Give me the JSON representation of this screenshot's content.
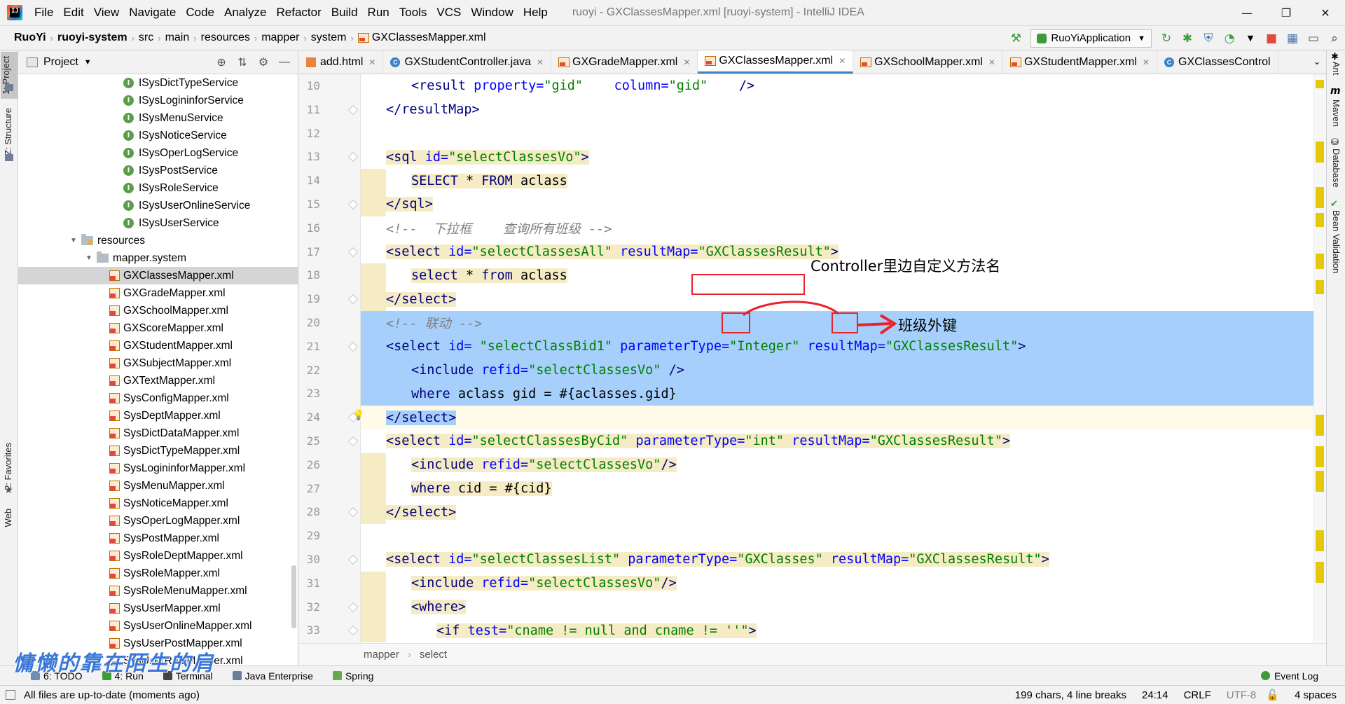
{
  "window": {
    "title": "ruoyi - GXClassesMapper.xml [ruoyi-system] - IntelliJ IDEA",
    "logo_text": "IJ",
    "menu": [
      "File",
      "Edit",
      "View",
      "Navigate",
      "Code",
      "Analyze",
      "Refactor",
      "Build",
      "Run",
      "Tools",
      "VCS",
      "Window",
      "Help"
    ],
    "minimize": "—",
    "maximize": "❐",
    "close": "✕"
  },
  "navbar": {
    "breadcrumb": [
      "RuoYi",
      "ruoyi-system",
      "src",
      "main",
      "resources",
      "mapper",
      "system",
      "GXClassesMapper.xml"
    ],
    "run_config": "RuoYiApplication"
  },
  "left_stripe": {
    "project": "1: Project",
    "structure": "Z: Structure",
    "favorites": "2: Favorites",
    "web": "Web"
  },
  "right_stripe": {
    "ant": "Ant",
    "maven": "Maven",
    "database": "Database",
    "bean": "Bean Validation"
  },
  "project_panel": {
    "title": "Project",
    "tree": [
      {
        "label": "ISysDictTypeService",
        "type": "interface",
        "indent": 150
      },
      {
        "label": "ISysLogininforService",
        "type": "interface",
        "indent": 150
      },
      {
        "label": "ISysMenuService",
        "type": "interface",
        "indent": 150
      },
      {
        "label": "ISysNoticeService",
        "type": "interface",
        "indent": 150
      },
      {
        "label": "ISysOperLogService",
        "type": "interface",
        "indent": 150
      },
      {
        "label": "ISysPostService",
        "type": "interface",
        "indent": 150
      },
      {
        "label": "ISysRoleService",
        "type": "interface",
        "indent": 150
      },
      {
        "label": "ISysUserOnlineService",
        "type": "interface",
        "indent": 150
      },
      {
        "label": "ISysUserService",
        "type": "interface",
        "indent": 150
      },
      {
        "label": "resources",
        "type": "res-folder",
        "indent": 72,
        "arrow": "▼"
      },
      {
        "label": "mapper.system",
        "type": "folder",
        "indent": 94,
        "arrow": "▼"
      },
      {
        "label": "GXClassesMapper.xml",
        "type": "xml",
        "indent": 130,
        "selected": true
      },
      {
        "label": "GXGradeMapper.xml",
        "type": "xml",
        "indent": 130
      },
      {
        "label": "GXSchoolMapper.xml",
        "type": "xml",
        "indent": 130
      },
      {
        "label": "GXScoreMapper.xml",
        "type": "xml",
        "indent": 130
      },
      {
        "label": "GXStudentMapper.xml",
        "type": "xml",
        "indent": 130
      },
      {
        "label": "GXSubjectMapper.xml",
        "type": "xml",
        "indent": 130
      },
      {
        "label": "GXTextMapper.xml",
        "type": "xml",
        "indent": 130
      },
      {
        "label": "SysConfigMapper.xml",
        "type": "xml",
        "indent": 130
      },
      {
        "label": "SysDeptMapper.xml",
        "type": "xml",
        "indent": 130
      },
      {
        "label": "SysDictDataMapper.xml",
        "type": "xml",
        "indent": 130
      },
      {
        "label": "SysDictTypeMapper.xml",
        "type": "xml",
        "indent": 130
      },
      {
        "label": "SysLogininforMapper.xml",
        "type": "xml",
        "indent": 130
      },
      {
        "label": "SysMenuMapper.xml",
        "type": "xml",
        "indent": 130
      },
      {
        "label": "SysNoticeMapper.xml",
        "type": "xml",
        "indent": 130
      },
      {
        "label": "SysOperLogMapper.xml",
        "type": "xml",
        "indent": 130
      },
      {
        "label": "SysPostMapper.xml",
        "type": "xml",
        "indent": 130
      },
      {
        "label": "SysRoleDeptMapper.xml",
        "type": "xml",
        "indent": 130
      },
      {
        "label": "SysRoleMapper.xml",
        "type": "xml",
        "indent": 130
      },
      {
        "label": "SysRoleMenuMapper.xml",
        "type": "xml",
        "indent": 130
      },
      {
        "label": "SysUserMapper.xml",
        "type": "xml",
        "indent": 130
      },
      {
        "label": "SysUserOnlineMapper.xml",
        "type": "xml",
        "indent": 130
      },
      {
        "label": "SysUserPostMapper.xml",
        "type": "xml",
        "indent": 130
      },
      {
        "label": "SysUserRoleMapper.xml",
        "type": "xml",
        "indent": 130
      }
    ]
  },
  "tabs": [
    {
      "label": "add.html",
      "icon": "html"
    },
    {
      "label": "GXStudentController.java",
      "icon": "class"
    },
    {
      "label": "GXGradeMapper.xml",
      "icon": "xml"
    },
    {
      "label": "GXClassesMapper.xml",
      "icon": "xml",
      "active": true
    },
    {
      "label": "GXSchoolMapper.xml",
      "icon": "xml"
    },
    {
      "label": "GXStudentMapper.xml",
      "icon": "xml"
    },
    {
      "label": "GXClassesControl",
      "icon": "class"
    }
  ],
  "tabs_overflow": "⌄",
  "editor": {
    "lines": [
      {
        "n": "10",
        "hl": "none",
        "indent": 2,
        "parts": [
          [
            "tag",
            "<result "
          ],
          [
            "attr",
            "property="
          ],
          [
            "val",
            "\"gid\""
          ],
          [
            "plain",
            "    "
          ],
          [
            "attr",
            "column="
          ],
          [
            "val",
            "\"gid\""
          ],
          [
            "plain",
            "    "
          ],
          [
            "tag",
            "/>"
          ]
        ]
      },
      {
        "n": "11",
        "hl": "none",
        "indent": 1,
        "parts": [
          [
            "tag",
            "</resultMap>"
          ]
        ]
      },
      {
        "n": "12",
        "hl": "none",
        "indent": 0,
        "parts": []
      },
      {
        "n": "13",
        "hl": "yellow",
        "indent": 1,
        "parts": [
          [
            "tag",
            "<sql "
          ],
          [
            "attr",
            "id="
          ],
          [
            "val",
            "\"selectClassesVo\""
          ],
          [
            "tag",
            ">"
          ]
        ]
      },
      {
        "n": "14",
        "hl": "yellow",
        "indent": 2,
        "parts": [
          [
            "sql",
            "SELECT"
          ],
          [
            "plain",
            " * "
          ],
          [
            "sql",
            "FROM"
          ],
          [
            "plain",
            " aclass"
          ]
        ]
      },
      {
        "n": "15",
        "hl": "yellow",
        "indent": 1,
        "parts": [
          [
            "tag",
            "</sql>"
          ]
        ]
      },
      {
        "n": "16",
        "hl": "none",
        "indent": 1,
        "parts": [
          [
            "cmt",
            "<!--  下拉框    查询所有班级 -->"
          ]
        ]
      },
      {
        "n": "17",
        "hl": "yellow",
        "indent": 1,
        "parts": [
          [
            "tag",
            "<select "
          ],
          [
            "attr",
            "id="
          ],
          [
            "val",
            "\"selectClassesAll\""
          ],
          [
            "plain",
            " "
          ],
          [
            "attr",
            "resultMap="
          ],
          [
            "val",
            "\"GXClassesResult\""
          ],
          [
            "tag",
            ">"
          ]
        ]
      },
      {
        "n": "18",
        "hl": "yellow",
        "indent": 2,
        "parts": [
          [
            "sql",
            "select"
          ],
          [
            "plain",
            " * "
          ],
          [
            "sql",
            "from"
          ],
          [
            "plain",
            " aclass"
          ]
        ]
      },
      {
        "n": "19",
        "hl": "yellow",
        "indent": 1,
        "parts": [
          [
            "tag",
            "</select>"
          ]
        ]
      },
      {
        "n": "20",
        "hl": "blue",
        "indent": 1,
        "parts": [
          [
            "cmt",
            "<!-- 联动 -->"
          ]
        ]
      },
      {
        "n": "21",
        "hl": "blue",
        "indent": 1,
        "parts": [
          [
            "tag",
            "<select "
          ],
          [
            "attr",
            "id= "
          ],
          [
            "val",
            "\"selectClassBid1\""
          ],
          [
            "plain",
            " "
          ],
          [
            "attr",
            "parameterType="
          ],
          [
            "val",
            "\"Integer\""
          ],
          [
            "plain",
            " "
          ],
          [
            "attr",
            "resultMap="
          ],
          [
            "val",
            "\"GXClassesResult\""
          ],
          [
            "tag",
            ">"
          ]
        ]
      },
      {
        "n": "22",
        "hl": "blue",
        "indent": 2,
        "parts": [
          [
            "tag",
            "<include "
          ],
          [
            "attr",
            "refid="
          ],
          [
            "val",
            "\"selectClassesVo\""
          ],
          [
            "plain",
            " "
          ],
          [
            "tag",
            "/>"
          ]
        ]
      },
      {
        "n": "23",
        "hl": "blue",
        "indent": 2,
        "parts": [
          [
            "sql",
            "where"
          ],
          [
            "plain",
            " aclass "
          ],
          [
            "plain",
            "gid"
          ],
          [
            "plain",
            " = #{aclasses.gid}"
          ]
        ]
      },
      {
        "n": "24",
        "hl": "caret",
        "indent": 1,
        "parts": [
          [
            "tag",
            "</select>"
          ]
        ]
      },
      {
        "n": "25",
        "hl": "yellow",
        "indent": 1,
        "parts": [
          [
            "tag",
            "<select "
          ],
          [
            "attr",
            "id="
          ],
          [
            "val",
            "\"selectClassesByCid\""
          ],
          [
            "plain",
            " "
          ],
          [
            "attr",
            "parameterType="
          ],
          [
            "val",
            "\"int\""
          ],
          [
            "plain",
            " "
          ],
          [
            "attr",
            "resultMap="
          ],
          [
            "val",
            "\"GXClassesResult\""
          ],
          [
            "tag",
            ">"
          ]
        ]
      },
      {
        "n": "26",
        "hl": "yellow",
        "indent": 2,
        "parts": [
          [
            "tag",
            "<include "
          ],
          [
            "attr",
            "refid="
          ],
          [
            "val",
            "\"selectClassesVo\""
          ],
          [
            "tag",
            "/>"
          ]
        ]
      },
      {
        "n": "27",
        "hl": "yellow",
        "indent": 2,
        "parts": [
          [
            "sql",
            "where"
          ],
          [
            "plain",
            " cid = #{cid}"
          ]
        ]
      },
      {
        "n": "28",
        "hl": "yellow",
        "indent": 1,
        "parts": [
          [
            "tag",
            "</select>"
          ]
        ]
      },
      {
        "n": "29",
        "hl": "none",
        "indent": 0,
        "parts": []
      },
      {
        "n": "30",
        "hl": "yellow",
        "indent": 1,
        "parts": [
          [
            "tag",
            "<select "
          ],
          [
            "attr",
            "id="
          ],
          [
            "val",
            "\"selectClassesList\""
          ],
          [
            "plain",
            " "
          ],
          [
            "attr",
            "parameterType="
          ],
          [
            "val",
            "\"GXClasses\""
          ],
          [
            "plain",
            " "
          ],
          [
            "attr",
            "resultMap="
          ],
          [
            "val",
            "\"GXClassesResult\""
          ],
          [
            "tag",
            ">"
          ]
        ]
      },
      {
        "n": "31",
        "hl": "yellow",
        "indent": 2,
        "parts": [
          [
            "tag",
            "<include "
          ],
          [
            "attr",
            "refid="
          ],
          [
            "val",
            "\"selectClassesVo\""
          ],
          [
            "tag",
            "/>"
          ]
        ]
      },
      {
        "n": "32",
        "hl": "yellow",
        "indent": 2,
        "parts": [
          [
            "tag",
            "<where>"
          ]
        ]
      },
      {
        "n": "33",
        "hl": "yellow",
        "indent": 3,
        "parts": [
          [
            "tag",
            "<if "
          ],
          [
            "attr",
            "test="
          ],
          [
            "val",
            "\"cname != null and cname != ''\""
          ],
          [
            "tag",
            ">"
          ]
        ]
      }
    ],
    "annotation_method": "Controller里边自定义方法名",
    "annotation_fk": "班级外键",
    "crumb": [
      "mapper",
      "select"
    ]
  },
  "bottom_tools": [
    {
      "label": "6: TODO",
      "color": "#6e8db5"
    },
    {
      "label": "4: Run",
      "color": "#3e9b3a"
    },
    {
      "label": "Terminal",
      "color": "#444444"
    },
    {
      "label": "Java Enterprise",
      "color": "#6a7f9a"
    },
    {
      "label": "Spring",
      "color": "#6aa84f"
    }
  ],
  "event_log": "Event Log",
  "status": {
    "message": "All files are up-to-date (moments ago)",
    "chars": "199 chars, 4 line breaks",
    "position": "24:14",
    "line_sep": "CRLF",
    "encoding": "UTF-8",
    "indent": "4 spaces"
  },
  "watermark": "慵懒的靠在陌生的肩"
}
